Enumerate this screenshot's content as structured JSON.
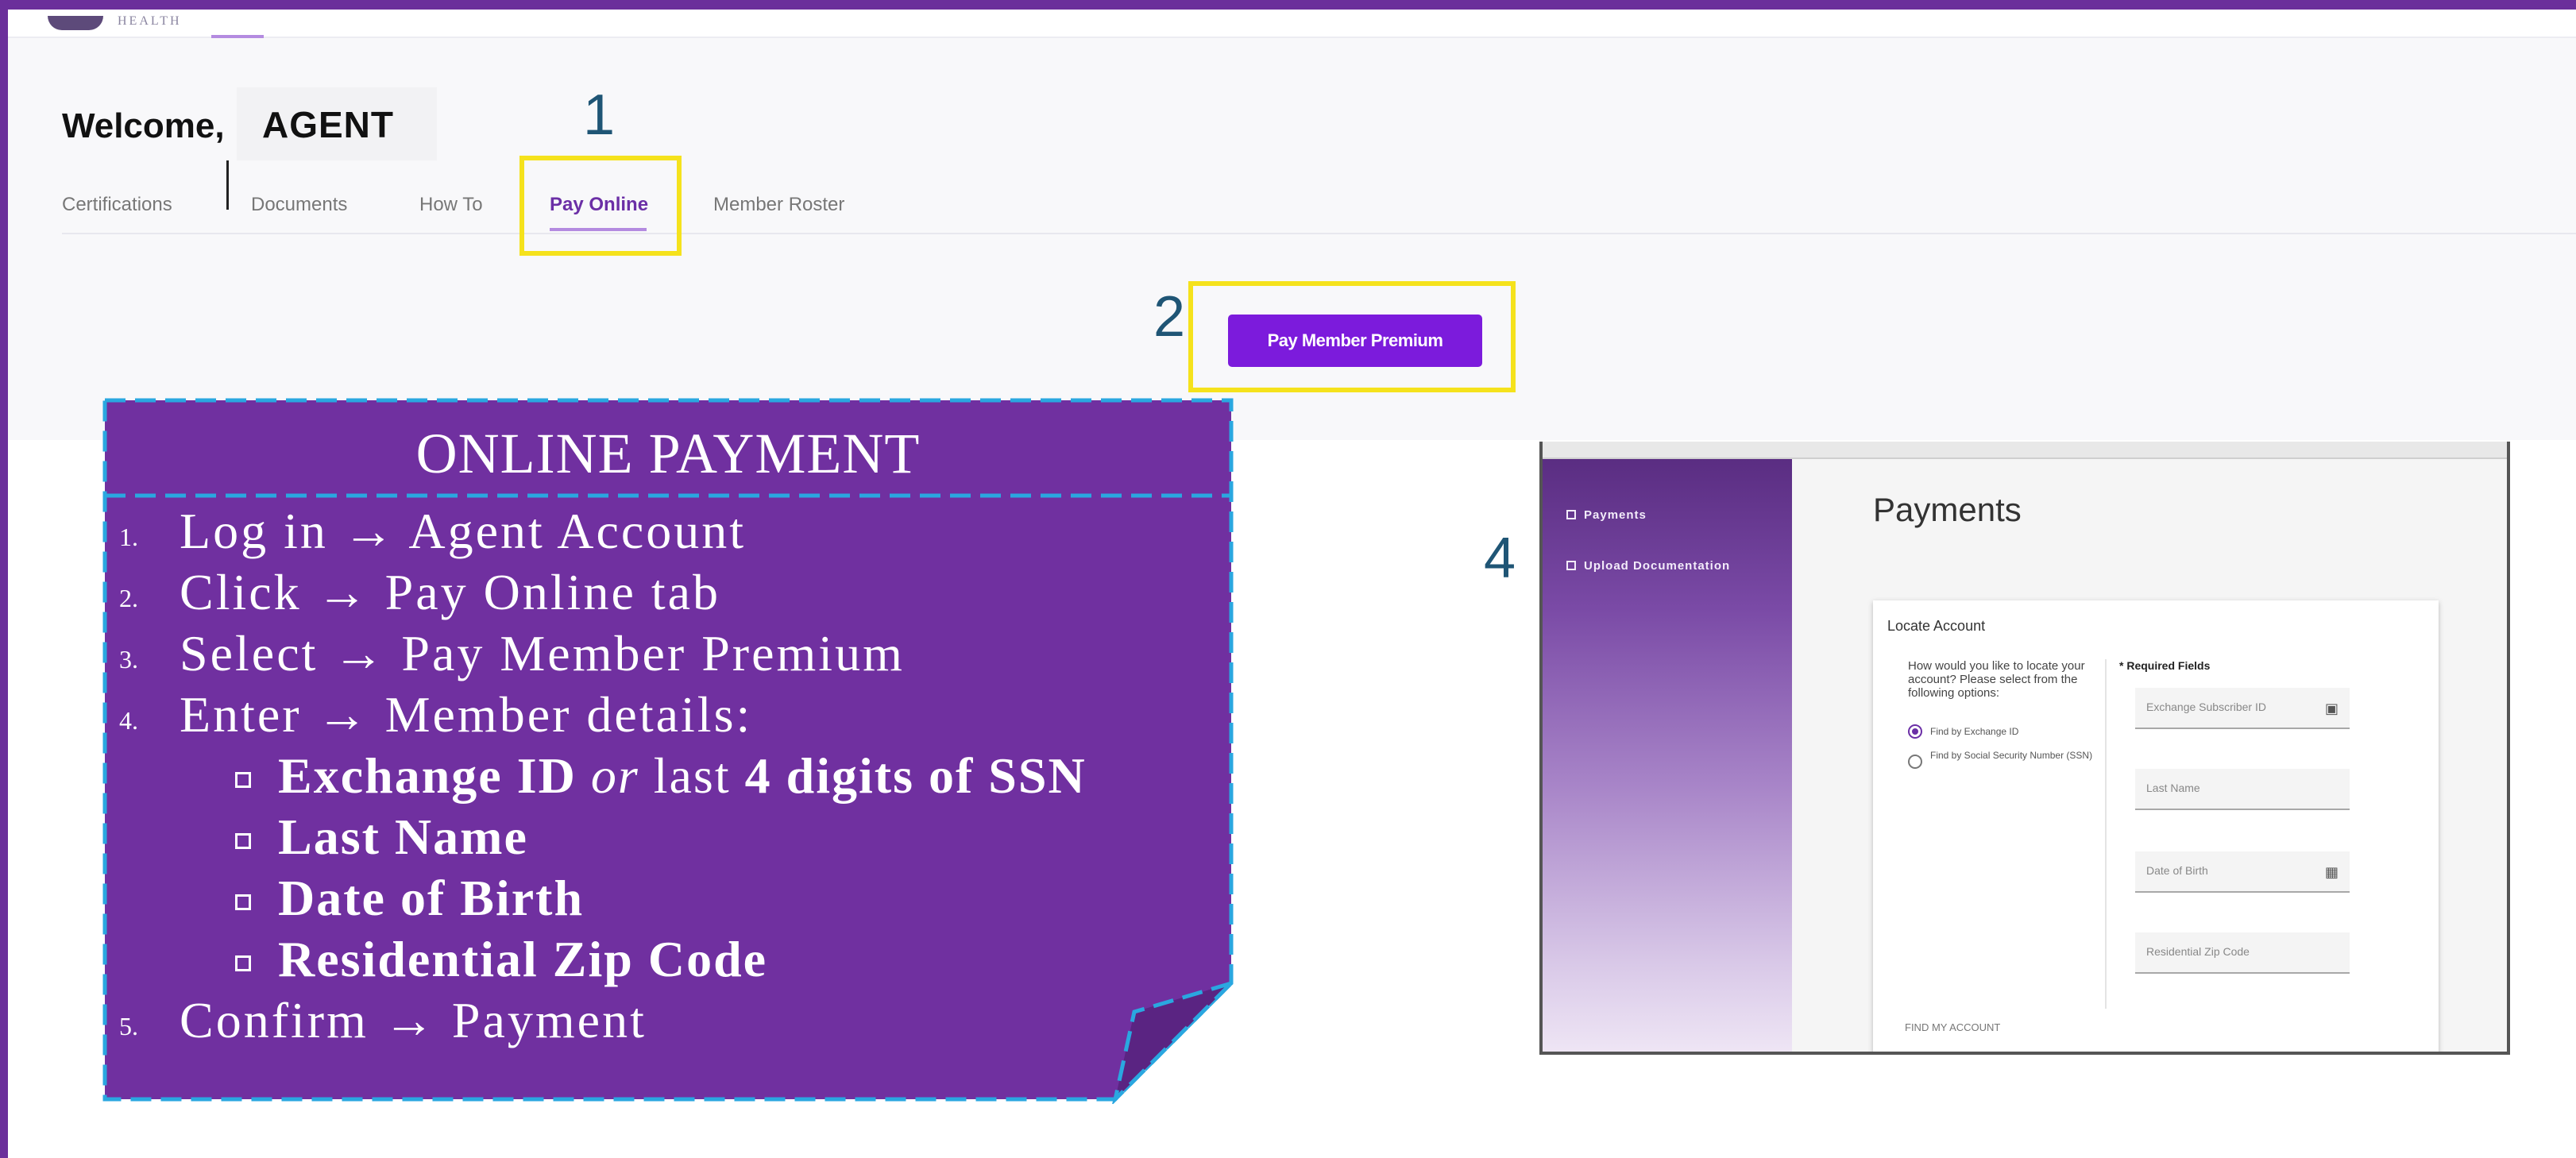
{
  "header": {
    "logo_text": "HEALTH"
  },
  "welcome": {
    "greeting": "Welcome,",
    "agent_name": "AGENT"
  },
  "tabs": [
    {
      "label": "Certifications",
      "active": false
    },
    {
      "label": "Documents",
      "active": false
    },
    {
      "label": "How To",
      "active": false
    },
    {
      "label": "Pay Online",
      "active": true
    },
    {
      "label": "Member Roster",
      "active": false
    }
  ],
  "callouts": {
    "step1": "1",
    "step2": "2",
    "step4": "4"
  },
  "pay_button": {
    "label": "Pay Member Premium"
  },
  "instructions": {
    "title": "ONLINE PAYMENT",
    "steps": [
      {
        "num": "1.",
        "text": "Log in → Agent Account"
      },
      {
        "num": "2.",
        "text": "Click → Pay Online tab"
      },
      {
        "num": "3.",
        "text": "Select → Pay Member Premium"
      },
      {
        "num": "4.",
        "text": "Enter → Member details:"
      },
      {
        "num": "5.",
        "text": "Confirm → Payment"
      }
    ],
    "details": {
      "exchange_id": "Exchange ID",
      "or_word": "or",
      "last_word": "last",
      "ssn_part": "4 digits of SSN",
      "last_name": "Last Name",
      "dob": "Date of Birth",
      "zip": "Residential Zip Code"
    }
  },
  "screenshot": {
    "sidebar": [
      {
        "label": "Payments",
        "icon": "dollar-icon"
      },
      {
        "label": "Upload Documentation",
        "icon": "document-icon"
      }
    ],
    "page_title": "Payments",
    "card": {
      "title": "Locate Account",
      "question": "How would you like to locate your account? Please select from the following options:",
      "options": [
        {
          "label": "Find by Exchange ID",
          "selected": true
        },
        {
          "label": "Find by Social Security Number (SSN)",
          "selected": false
        }
      ],
      "required_note": "* Required Fields",
      "fields": [
        {
          "label": "Exchange Subscriber ID",
          "icon": "id-card-icon"
        },
        {
          "label": "Last Name"
        },
        {
          "label": "Date of Birth",
          "icon": "calendar-icon"
        },
        {
          "label": "Residential Zip Code"
        }
      ],
      "action": "FIND MY ACCOUNT"
    }
  },
  "colors": {
    "brand_purple": "#6b2f9b",
    "button_purple": "#7c1bdc",
    "highlight_yellow": "#f5e21c",
    "callout_blue": "#1f5575",
    "note_fill": "#7030a0",
    "note_border": "#2aa7e0"
  }
}
